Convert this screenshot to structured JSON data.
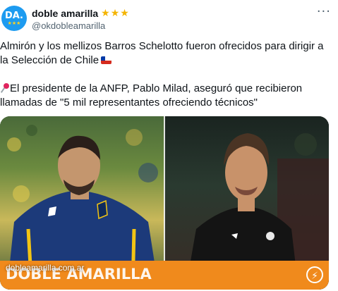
{
  "account": {
    "display_name": "doble amarilla",
    "badge_stars": "★★★",
    "handle": "@okdobleamarilla",
    "avatar": {
      "text": "DA.",
      "stars": "★★★"
    }
  },
  "more_menu_icon": "more-dots-icon",
  "tweet": {
    "paragraph1": "Almirón y los mellizos Barros Schelotto fueron ofrecidos para dirigir a la Selección de Chile",
    "paragraph1_emoji": "chile-flag",
    "paragraph2": "El presidente de la ANFP, Pablo Milad, aseguró que recibieron llamadas de \"5 mil representantes ofreciendo técnicos\"",
    "paragraph2_emoji": "pushpin"
  },
  "media": {
    "banner_title": "DOBLE AMARILLA",
    "banner_url": "dobleamarilla.com.ar",
    "banner_color": "#f08a1c",
    "bolt_icon": "lightning-icon"
  }
}
